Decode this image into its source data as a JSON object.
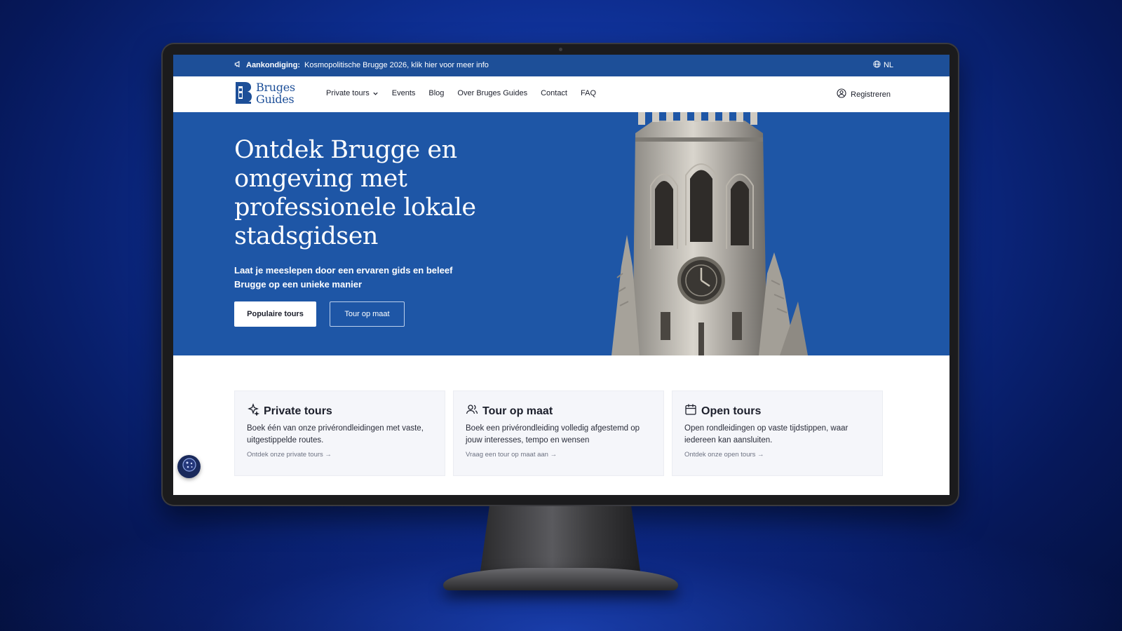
{
  "announcement": {
    "label": "Aankondiging:",
    "text": "Kosmopolitische Brugge 2026, klik hier voor meer info",
    "icon": "megaphone-icon"
  },
  "language": {
    "code": "NL",
    "icon": "globe-icon"
  },
  "logo": {
    "line1": "Bruges",
    "line2": "Guides"
  },
  "nav": {
    "items": [
      "Private tours",
      "Events",
      "Blog",
      "Over Bruges Guides",
      "Contact",
      "FAQ"
    ],
    "register": "Registreren"
  },
  "hero": {
    "title": "Ontdek Brugge en omgeving met professionele lokale stadsgidsen",
    "subtitle": "Laat je meeslepen door een ervaren gids en beleef Brugge op een unieke manier",
    "primary_button": "Populaire tours",
    "secondary_button": "Tour op maat"
  },
  "cards": [
    {
      "icon": "sparkle-icon",
      "title": "Private tours",
      "text": "Boek één van onze privérondleidingen met vaste, uitgestippelde routes.",
      "link": "Ontdek onze private tours →"
    },
    {
      "icon": "users-icon",
      "title": "Tour op maat",
      "text": "Boek een privérondleiding volledig afgestemd op jouw interesses, tempo en wensen",
      "link": "Vraag een tour op maat aan →"
    },
    {
      "icon": "calendar-icon",
      "title": "Open tours",
      "text": "Open rondleidingen op vaste tijdstippen, waar iedereen kan aansluiten.",
      "link": "Ontdek onze open tours →"
    }
  ],
  "colors": {
    "brand_blue": "#1e56a6",
    "announcement_bar": "#1d4f98",
    "background": "#0d2d8f"
  }
}
